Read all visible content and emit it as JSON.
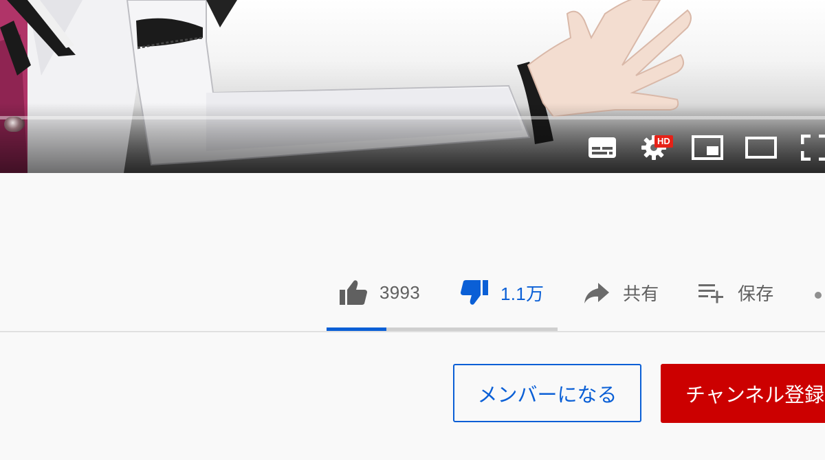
{
  "player": {
    "video_label": "video frame",
    "progress_fraction": 0.005,
    "controls": {
      "subtitles": "subtitles-icon",
      "settings": "settings-gear-icon",
      "settings_badge": "HD",
      "miniplayer": "miniplayer-icon",
      "theater": "theater-mode-icon",
      "fullscreen": "fullscreen-icon"
    }
  },
  "actions": {
    "like": {
      "icon": "thumbs-up-icon",
      "count": "3993"
    },
    "dislike": {
      "icon": "thumbs-down-icon",
      "count": "1.1万",
      "active": true,
      "color": "#0a5fd6"
    },
    "share": {
      "icon": "share-arrow-icon",
      "label": "共有"
    },
    "save": {
      "icon": "playlist-add-icon",
      "label": "保存"
    },
    "more": {
      "icon": "more-dots-icon"
    }
  },
  "sentiment": {
    "like_fraction": 0.26,
    "like_color": "#0a5fd6",
    "track_color": "#cfcfcf"
  },
  "buttons": {
    "join": "メンバーになる",
    "subscribe": "チャンネル登録"
  },
  "colors": {
    "accent_blue": "#0a5fd6",
    "subscribe_red": "#cc0000",
    "hd_red": "#e62117"
  }
}
